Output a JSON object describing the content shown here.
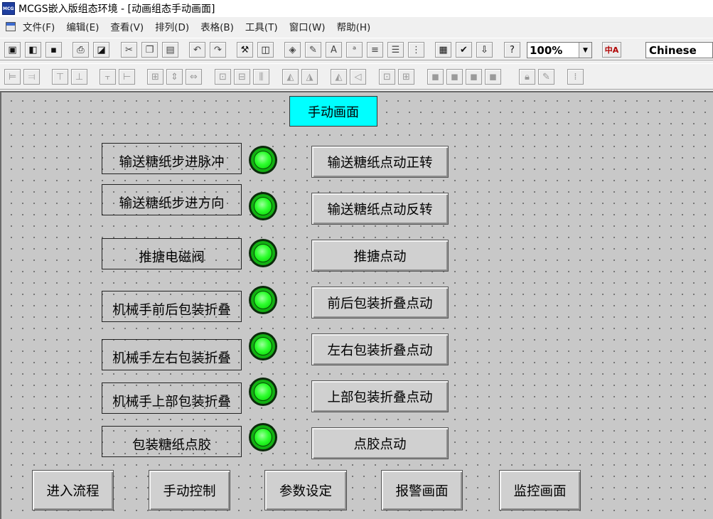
{
  "window": {
    "app_logo": "MCGS",
    "title": "MCGS嵌入版组态环境 - [动画组态手动画面]"
  },
  "menu": [
    {
      "label": "文件(F)"
    },
    {
      "label": "编辑(E)"
    },
    {
      "label": "查看(V)"
    },
    {
      "label": "排列(D)"
    },
    {
      "label": "表格(B)"
    },
    {
      "label": "工具(T)"
    },
    {
      "label": "窗口(W)"
    },
    {
      "label": "帮助(H)"
    }
  ],
  "toolbar": {
    "zoom": "100%",
    "language": "Chinese",
    "lang_icon": "中A"
  },
  "screen": {
    "title": "手动画面",
    "rows": [
      {
        "label": "输送糖纸步进脉冲",
        "button": "输送糖纸点动正转"
      },
      {
        "label": "输送糖纸步进方向",
        "button": "输送糖纸点动反转"
      },
      {
        "label": "推搪电磁阀",
        "button": "推搪点动"
      },
      {
        "label": "机械手前后包装折叠",
        "button": "前后包装折叠点动"
      },
      {
        "label": "机械手左右包装折叠",
        "button": "左右包装折叠点动"
      },
      {
        "label": "机械手上部包装折叠",
        "button": "上部包装折叠点动"
      },
      {
        "label": "包装糖纸点胶",
        "button": "点胶点动"
      }
    ],
    "nav_buttons": [
      {
        "label": "进入流程"
      },
      {
        "label": "手动控制"
      },
      {
        "label": "参数设定"
      },
      {
        "label": "报警画面"
      },
      {
        "label": "监控画面"
      }
    ],
    "led_color": "#00ff00",
    "title_bg": "#00ffff"
  }
}
